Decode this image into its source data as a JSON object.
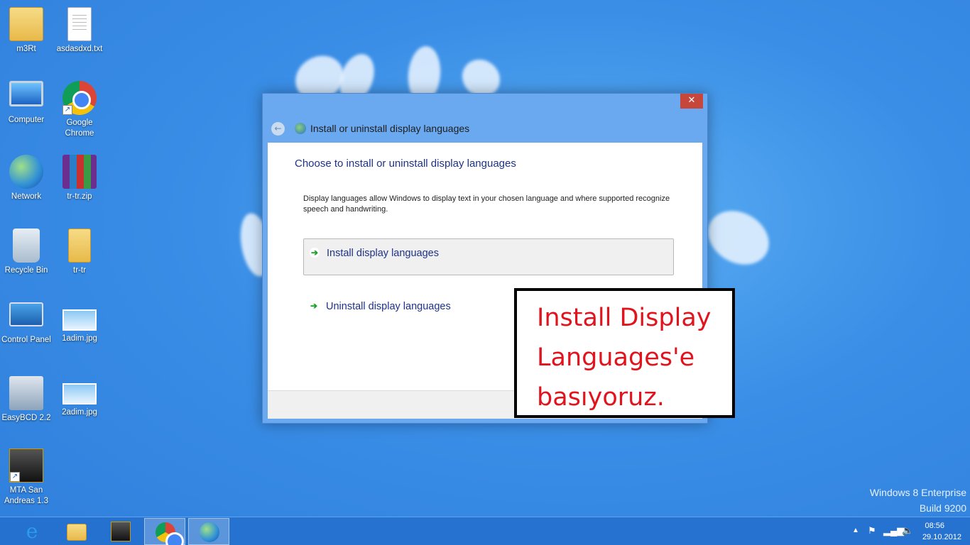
{
  "desktop": {
    "icons": [
      {
        "label": "m3Rt",
        "icon": "user-folder-icon"
      },
      {
        "label": "asdasdxd.txt",
        "icon": "text-file-icon"
      },
      {
        "label": "Computer",
        "icon": "computer-icon"
      },
      {
        "label": "Google Chrome",
        "icon": "chrome-icon"
      },
      {
        "label": "Network",
        "icon": "network-icon"
      },
      {
        "label": "tr-tr.zip",
        "icon": "winrar-archive-icon"
      },
      {
        "label": "Recycle Bin",
        "icon": "recycle-bin-icon"
      },
      {
        "label": "tr-tr",
        "icon": "folder-icon"
      },
      {
        "label": "Control Panel",
        "icon": "control-panel-icon"
      },
      {
        "label": "1adim.jpg",
        "icon": "image-file-icon"
      },
      {
        "label": "EasyBCD 2.2",
        "icon": "easybcd-icon"
      },
      {
        "label": "2adim.jpg",
        "icon": "image-file-icon"
      },
      {
        "label": "MTA San Andreas 1.3",
        "icon": "mta-icon"
      }
    ]
  },
  "window": {
    "close_label": "✕",
    "address_title": "Install or uninstall display languages",
    "heading": "Choose to install or uninstall display languages",
    "description": "Display languages allow Windows to display text in your chosen language and where supported recognize speech and handwriting.",
    "option_install": "Install display languages",
    "option_uninstall": "Uninstall display languages"
  },
  "annotation": {
    "line1": "Install Display",
    "line2": "Languages'e",
    "line3": "basıyoruz."
  },
  "watermark": {
    "edition": "Windows 8 Enterprise",
    "build": "Build 9200"
  },
  "taskbar": {
    "apps": [
      "internet-explorer-icon",
      "file-explorer-icon",
      "mta-icon",
      "chrome-icon",
      "language-settings-icon"
    ],
    "clock_time": "08:56",
    "clock_date": "29.10.2012"
  },
  "colors": {
    "accent": "#2f7fdc",
    "annotation_text": "#e1141e",
    "heading_text": "#1e3287",
    "close_button": "#c7463c"
  }
}
